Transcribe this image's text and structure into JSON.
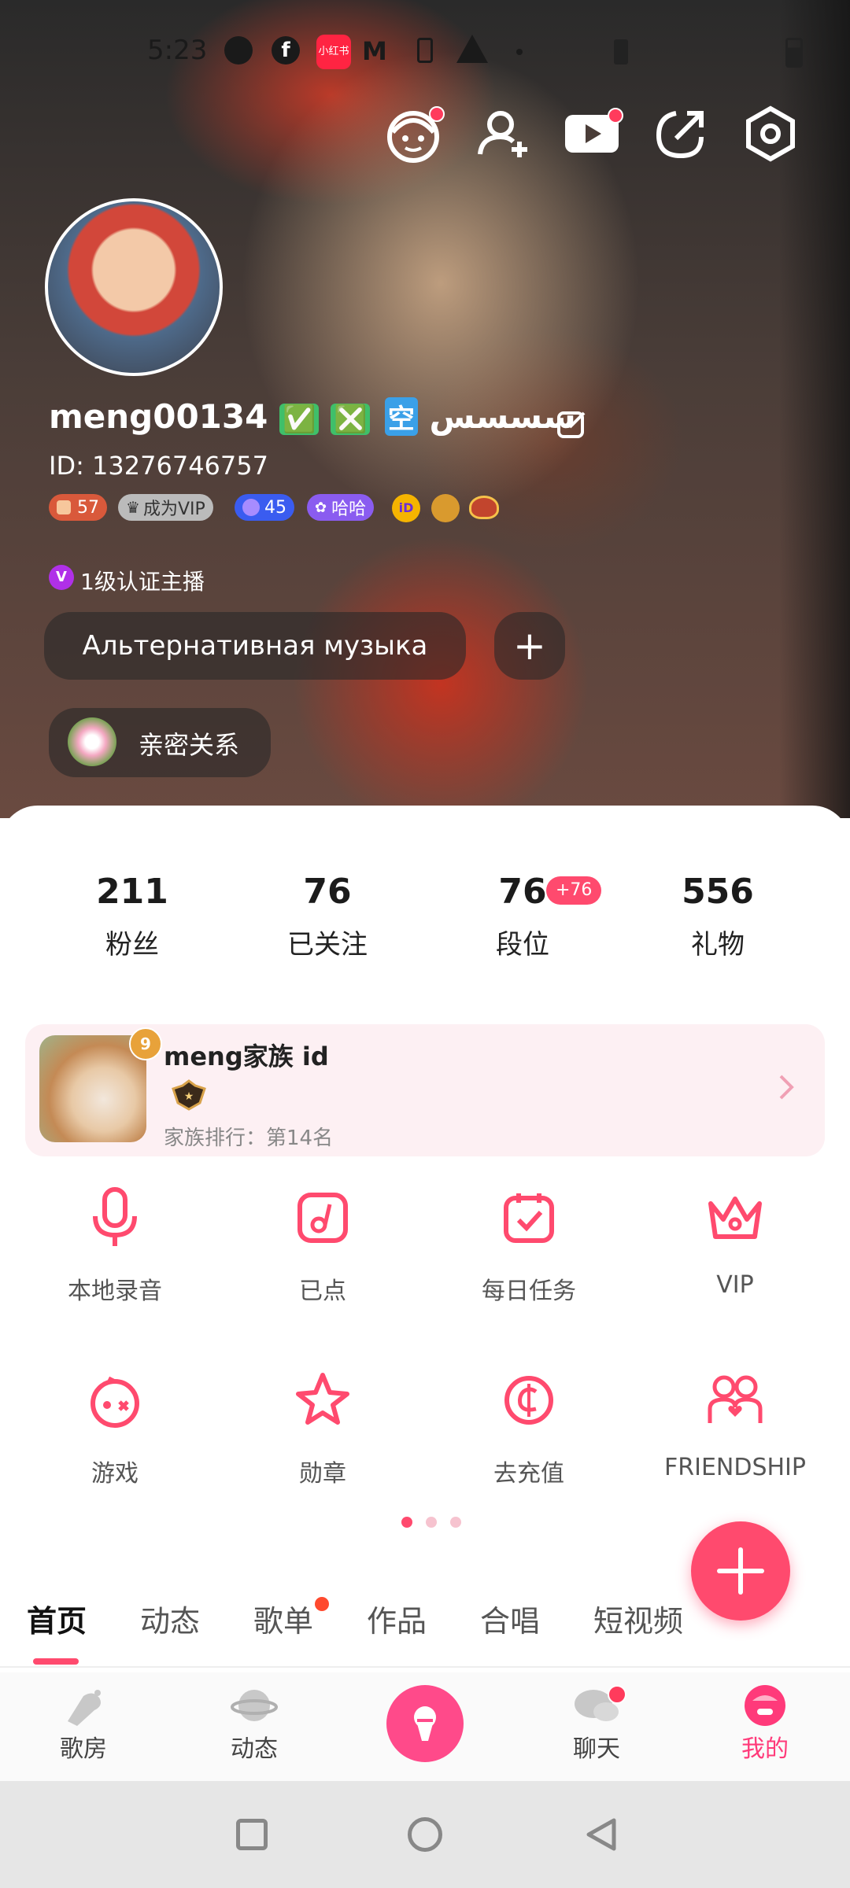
{
  "status_bar": {
    "time": "5:23",
    "xhs_badge": "小红书"
  },
  "profile": {
    "name": "meng001سسسس",
    "name_suffix": "34",
    "name_chars": [
      "空",
      "❎",
      "✅"
    ],
    "id_line": "ID: 13276746757",
    "badges": {
      "level": "57",
      "vip": "成为VIP",
      "rank": "45",
      "haha": "哈哈",
      "id_icon": "iD"
    },
    "certification": "1级认证主播",
    "cert_icon_text": "V",
    "music_tag": "Альтернативная музыка",
    "add_tag_symbol": "+",
    "intimate": "亲密关系"
  },
  "stats": [
    {
      "value": "211",
      "label": "粉丝"
    },
    {
      "value": "76",
      "label": "已关注"
    },
    {
      "value": "76",
      "label": "段位",
      "badge": "+76"
    },
    {
      "value": "556",
      "label": "礼物"
    }
  ],
  "family": {
    "title": "meng家族 id",
    "level": "9",
    "rank_text": "家族排行：第14名"
  },
  "grid": [
    {
      "label": "本地录音",
      "icon": "microphone-icon"
    },
    {
      "label": "已点",
      "icon": "music-note-icon"
    },
    {
      "label": "每日任务",
      "icon": "calendar-check-icon"
    },
    {
      "label": "VIP",
      "icon": "crown-icon"
    },
    {
      "label": "游戏",
      "icon": "game-robot-icon"
    },
    {
      "label": "勋章",
      "icon": "star-medal-icon"
    },
    {
      "label": "去充值",
      "icon": "coin-icon"
    },
    {
      "label": "FRIENDSHIP",
      "icon": "friends-heart-icon"
    }
  ],
  "tabs": [
    "首页",
    "动态",
    "歌单",
    "作品",
    "合唱",
    "短视频"
  ],
  "bottom_nav": [
    {
      "label": "歌房",
      "icon": "microphone-room-icon"
    },
    {
      "label": "动态",
      "icon": "planet-icon"
    },
    {
      "label": "",
      "icon": "center-mic-icon"
    },
    {
      "label": "聊天",
      "icon": "chat-bubble-icon"
    },
    {
      "label": "我的",
      "icon": "profile-face-icon"
    }
  ],
  "colors": {
    "accent": "#ff4a6e",
    "active_nav": "#ff3a7a"
  }
}
